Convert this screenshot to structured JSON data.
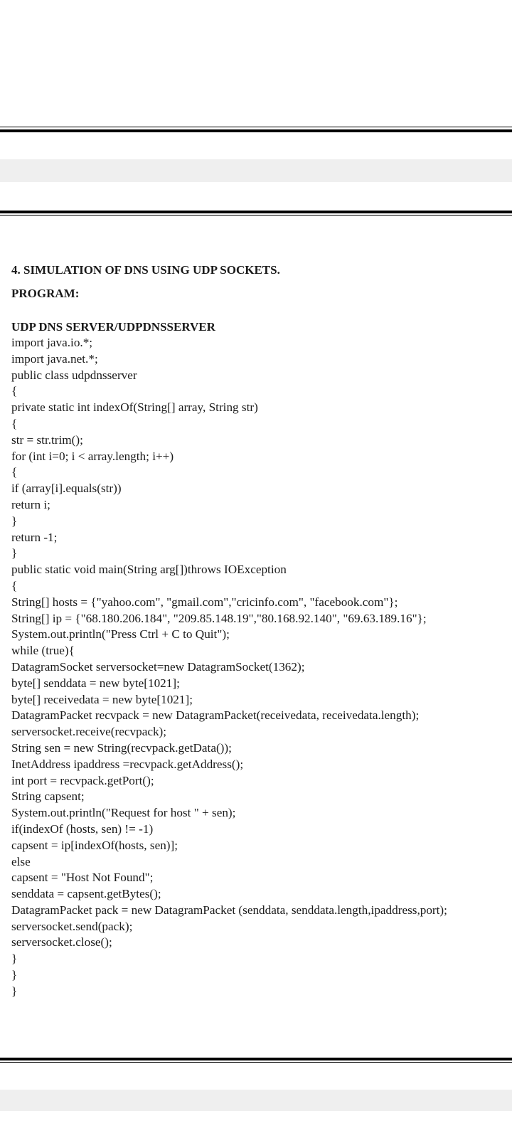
{
  "document": {
    "title": "4. SIMULATION OF DNS USING UDP SOCKETS.",
    "program_label": "PROGRAM:",
    "section_label": "UDP DNS SERVER/UDPDNSSERVER",
    "code_lines": [
      "import java.io.*;",
      "import java.net.*;",
      "public class udpdnsserver",
      "{",
      "private static int indexOf(String[] array, String str)",
      "{",
      "str = str.trim();",
      "for (int i=0; i < array.length; i++)",
      "{",
      "if (array[i].equals(str))",
      "return i;",
      "}",
      "return -1;",
      "}",
      "public static void main(String arg[])throws IOException",
      "{",
      "String[] hosts = {\"yahoo.com\", \"gmail.com\",\"cricinfo.com\", \"facebook.com\"};",
      "String[] ip = {\"68.180.206.184\", \"209.85.148.19\",\"80.168.92.140\", \"69.63.189.16\"};",
      "System.out.println(\"Press Ctrl + C to Quit\");",
      "while (true){",
      "DatagramSocket serversocket=new DatagramSocket(1362);",
      "byte[] senddata = new byte[1021];",
      "byte[] receivedata = new byte[1021];",
      "DatagramPacket recvpack = new DatagramPacket(receivedata, receivedata.length);",
      "serversocket.receive(recvpack);",
      "String sen = new String(recvpack.getData());",
      "InetAddress ipaddress =recvpack.getAddress();",
      "int port = recvpack.getPort();",
      "String capsent;",
      "System.out.println(\"Request for host \" + sen);",
      "if(indexOf (hosts, sen) != -1)",
      "capsent = ip[indexOf(hosts, sen)];",
      "else",
      "capsent = \"Host Not Found\";",
      "senddata = capsent.getBytes();",
      "DatagramPacket pack = new DatagramPacket (senddata, senddata.length,ipaddress,port);",
      "serversocket.send(pack);",
      "serversocket.close();",
      "}",
      "}",
      "}"
    ]
  }
}
